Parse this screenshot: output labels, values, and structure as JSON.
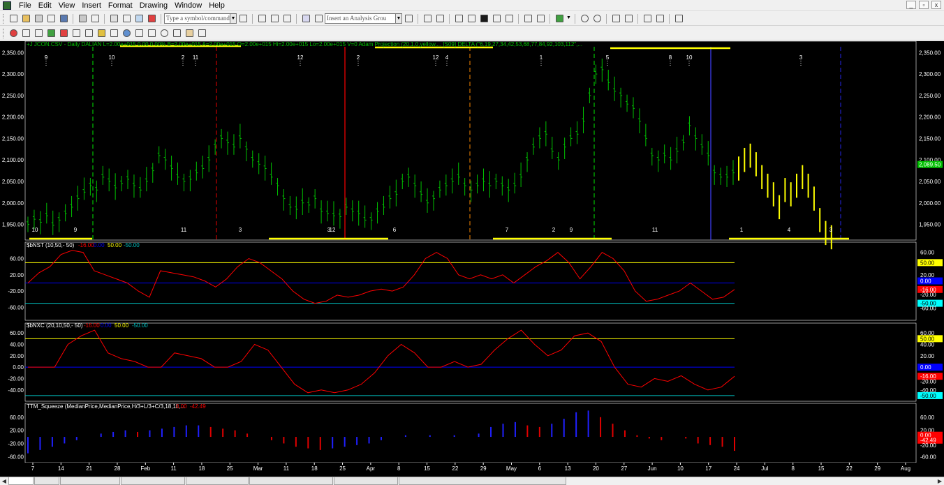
{
  "menu": {
    "items": [
      "File",
      "Edit",
      "View",
      "Insert",
      "Format",
      "Drawing",
      "Window",
      "Help"
    ]
  },
  "window_controls": {
    "minimize": "_",
    "restore": "▫",
    "close": "x"
  },
  "toolbar": {
    "symbol_placeholder": "Type a symbol/command",
    "analysis_placeholder": "Insert an Analysis Grou"
  },
  "chart": {
    "header_text": "+J JCON.CSV - Daily  DALIAN   L=2.00e+015  0.00  0.00%  B=2.00e+015  A=2.00e+015  O=2.00e+015  Hi=2.00e+015  Lo=2.00e+015  V=0   Adam Projection (20,1,0,yellow,...   [S09] DELTA (\"6,19,27,34,42,53,68,77,84,92,103,112\",...",
    "price_ticks": [
      "2,350.00",
      "2,300.00",
      "2,250.00",
      "2,200.00",
      "2,150.00",
      "2,100.00",
      "2,050.00",
      "2,000.00",
      "1,950.00"
    ],
    "last_price": "2,089.50",
    "delta_top": [
      {
        "label": "9"
      },
      {
        "label": "10"
      },
      {
        "label": "11"
      },
      {
        "label": "12"
      },
      {
        "label": "2"
      },
      {
        "label": "4"
      },
      {
        "label": "1"
      },
      {
        "label": "5"
      },
      {
        "label": "8"
      },
      {
        "label": "10"
      },
      {
        "label": "3"
      },
      {
        "label": "12"
      },
      {
        "label": "2"
      }
    ],
    "delta_bottom": [
      {
        "label": "10"
      },
      {
        "label": "9"
      },
      {
        "label": "11"
      },
      {
        "label": "3"
      },
      {
        "label": "3"
      },
      {
        "label": "12"
      },
      {
        "label": "6"
      },
      {
        "label": "7"
      },
      {
        "label": "2"
      },
      {
        "label": "9"
      },
      {
        "label": "11"
      },
      {
        "label": "1"
      },
      {
        "label": "4"
      },
      {
        "label": "3"
      }
    ]
  },
  "nst": {
    "title": "$bNST (10,50,- 50)",
    "p1": "-16.00",
    "p2": "0.00",
    "p3": "50.00",
    "p4": "-50.00",
    "ticks": [
      "60.00",
      "20.00",
      "-20.00",
      "-60.00"
    ],
    "right_labels": {
      "upper": "50.00",
      "up2": "20.00",
      "zero": "0.00",
      "value": "-16.00",
      "lower": "-50.00",
      "low2": "-20.00",
      "top": "60.00",
      "bottom": "-60.00"
    }
  },
  "nxc": {
    "title": "$bNXC (20,10,50,- 50)",
    "p1": "-16.00",
    "p2": "0.00",
    "p3": "50.00",
    "p4": "-50.00",
    "ticks": [
      "60.00",
      "40.00",
      "20.00",
      "0.00",
      "-20.00",
      "-40.00"
    ],
    "right_labels": {
      "top": "60.00",
      "upper": "50.00",
      "l40": "40.00",
      "l20": "20.00",
      "zero": "0.00",
      "value": "-16.00",
      "l_20": "-20.00",
      "l_40": "-40.00",
      "lower": "-50.00"
    }
  },
  "ttm": {
    "title": "TTM_Squeeze (MedianPrice,MedianPrice,H/3+L/3+C/3,18,11,...",
    "p1": "0.00",
    "p2": "-42.49",
    "ticks": [
      "60.00",
      "20.00",
      "-20.00",
      "-60.00"
    ],
    "right_labels": {
      "top": "60.00",
      "l20": "20.00",
      "zero": "0.00",
      "value": "-42.49",
      "l_20": "-20.00",
      "l_60": "-60.00"
    }
  },
  "date_axis": [
    "7",
    "14",
    "21",
    "28",
    "Feb",
    "11",
    "18",
    "25",
    "Mar",
    "11",
    "18",
    "25",
    "Apr",
    "8",
    "15",
    "22",
    "29",
    "May",
    "6",
    "13",
    "20",
    "27",
    "Jun",
    "10",
    "17",
    "24",
    "Jul",
    "8",
    "15",
    "22",
    "29",
    "Aug"
  ],
  "colors": {
    "bar_up": "#00c000",
    "projection": "#ffff00",
    "oscillator": "#ff0000",
    "upper": "#ffff00",
    "zero": "#0000ff",
    "lower": "#00c0c0"
  },
  "chart_data": {
    "type": "bar",
    "series": [
      {
        "name": "JCON.CSV",
        "type": "ohlc",
        "values": [
          1950,
          1962,
          1955,
          1970,
          1948,
          1960,
          1975,
          1990,
          2010,
          2025,
          2040,
          2030,
          2060,
          2050,
          2035,
          2045,
          2055,
          2040,
          2030,
          2050,
          2075,
          2110,
          2100,
          2080,
          2060,
          2050,
          2055,
          2070,
          2080,
          2100,
          2130,
          2150,
          2140,
          2130,
          2150,
          2125,
          2100,
          2090,
          2080,
          2060,
          2040,
          2010,
          1990,
          1985,
          2000,
          1995,
          2010,
          1980,
          1975,
          1970,
          1968,
          1990,
          1980,
          1975,
          1960,
          1960,
          1980,
          1990,
          2010,
          2020,
          2050,
          2060,
          2040,
          2020,
          2000,
          2010,
          2030,
          2040,
          2050,
          2060,
          2040,
          2030,
          2040,
          2050,
          2040,
          2050,
          2040,
          2030,
          2040,
          2060,
          2100,
          2130,
          2150,
          2160,
          2120,
          2100,
          2130,
          2150,
          2160,
          2190,
          2250,
          2300,
          2310,
          2280,
          2260,
          2250,
          2230,
          2220,
          2190,
          2150,
          2110,
          2100,
          2110,
          2100,
          2120,
          2140,
          2180,
          2150,
          2130,
          2110,
          2070,
          2060,
          2060,
          2070
        ]
      },
      {
        "name": "Adam Projection",
        "values": [
          2080,
          2100,
          2110,
          2090,
          2060,
          2040,
          2020,
          1990,
          2030,
          2020,
          2040,
          2060,
          2040,
          2010,
          1960,
          1930,
          1920
        ]
      },
      {
        "name": "$bNST (10,50,- 50)",
        "values": [
          0,
          25,
          40,
          70,
          80,
          75,
          30,
          20,
          10,
          0,
          -20,
          -35,
          30,
          25,
          20,
          15,
          5,
          -10,
          10,
          40,
          60,
          50,
          30,
          10,
          -20,
          -40,
          -50,
          -45,
          -30,
          -35,
          -30,
          -20,
          -15,
          -20,
          -10,
          20,
          60,
          75,
          60,
          20,
          10,
          20,
          10,
          20,
          0,
          20,
          40,
          55,
          75,
          50,
          10,
          40,
          75,
          60,
          30,
          -20,
          -45,
          -40,
          -30,
          -20,
          0,
          -20,
          -40,
          -35,
          -16
        ]
      },
      {
        "name": "$bNXC (20,10,50,- 50)",
        "values": [
          0,
          0,
          0,
          40,
          55,
          65,
          25,
          15,
          10,
          0,
          0,
          25,
          20,
          15,
          0,
          0,
          10,
          40,
          30,
          0,
          -30,
          -45,
          -40,
          -45,
          -40,
          -30,
          -10,
          20,
          40,
          25,
          0,
          0,
          10,
          0,
          5,
          30,
          50,
          65,
          40,
          20,
          30,
          55,
          60,
          45,
          0,
          -30,
          -35,
          -20,
          -25,
          -15,
          -30,
          -40,
          -35,
          -16
        ]
      },
      {
        "name": "TTM_Squeeze",
        "values": [
          -50,
          -40,
          -30,
          -20,
          -10,
          0,
          10,
          15,
          20,
          15,
          20,
          25,
          30,
          35,
          35,
          30,
          25,
          20,
          10,
          0,
          -10,
          -20,
          -30,
          -35,
          -40,
          -35,
          -30,
          -25,
          -20,
          -10,
          0,
          5,
          0,
          5,
          0,
          5,
          0,
          10,
          30,
          40,
          45,
          35,
          30,
          40,
          55,
          75,
          80,
          60,
          40,
          20,
          5,
          -5,
          -10,
          0,
          -5,
          -20,
          -25,
          -30,
          -42.49
        ]
      }
    ],
    "ylim": [
      1920,
      2370
    ],
    "grid": false
  }
}
